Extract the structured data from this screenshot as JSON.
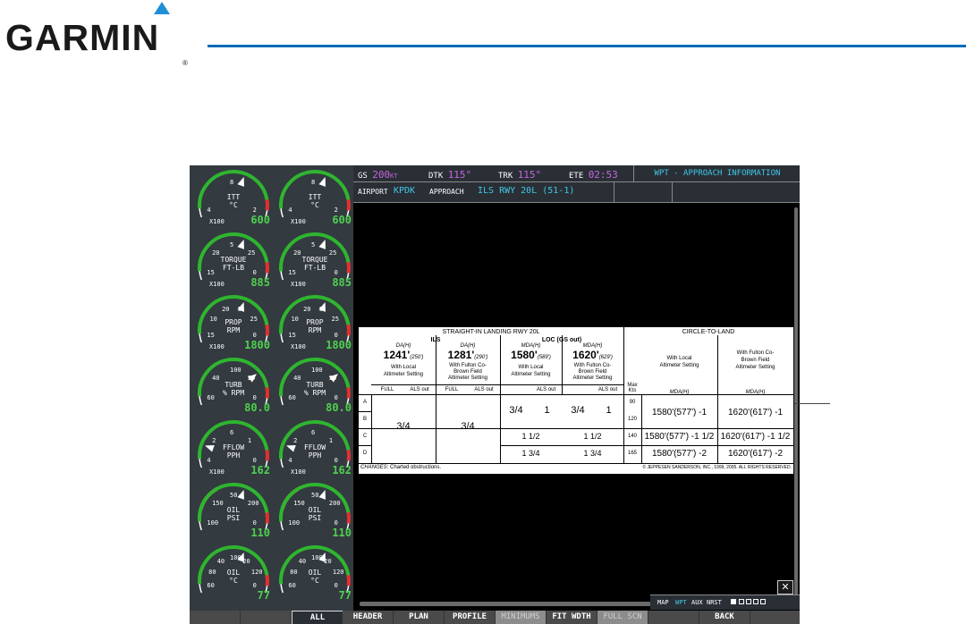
{
  "brand": {
    "name": "GARMIN",
    "reg": "®",
    "accent_color": "#1f8fd6"
  },
  "engine_gauges": [
    {
      "id": "itt-1",
      "label1": "ITT",
      "label2": "°C",
      "x100": "X100",
      "value": "600",
      "ticks": [
        "4",
        "8",
        "2"
      ]
    },
    {
      "id": "itt-2",
      "label1": "ITT",
      "label2": "°C",
      "x100": "X100",
      "value": "600",
      "ticks": [
        "4",
        "8",
        "2"
      ]
    },
    {
      "id": "torque-1",
      "label1": "TORQUE",
      "label2": "FT-LB",
      "x100": "X100",
      "value": "885",
      "ticks": [
        "15",
        "20",
        "5",
        "25",
        "0"
      ]
    },
    {
      "id": "torque-2",
      "label1": "TORQUE",
      "label2": "FT-LB",
      "x100": "X100",
      "value": "885",
      "ticks": [
        "15",
        "20",
        "5",
        "25",
        "0"
      ]
    },
    {
      "id": "prop-1",
      "label1": "PROP",
      "label2": "RPM",
      "x100": "X100",
      "value": "1800",
      "ticks": [
        "15",
        "10",
        "20",
        "5",
        "25",
        "0"
      ]
    },
    {
      "id": "prop-2",
      "label1": "PROP",
      "label2": "RPM",
      "x100": "X100",
      "value": "1800",
      "ticks": [
        "15",
        "10",
        "20",
        "5",
        "25",
        "0"
      ]
    },
    {
      "id": "turb-1",
      "label1": "TURB",
      "label2": "% RPM",
      "x100": "",
      "value": "80.0",
      "ticks": [
        "60",
        "40",
        "100",
        "20",
        "0"
      ]
    },
    {
      "id": "turb-2",
      "label1": "TURB",
      "label2": "% RPM",
      "x100": "",
      "value": "80.0",
      "ticks": [
        "60",
        "40",
        "100",
        "20",
        "0"
      ]
    },
    {
      "id": "fflow-1",
      "label1": "FFLOW",
      "label2": "PPH",
      "x100": "X100",
      "value": "162",
      "ticks": [
        "4",
        "2",
        "6",
        "1",
        "0"
      ]
    },
    {
      "id": "fflow-2",
      "label1": "FFLOW",
      "label2": "PPH",
      "x100": "X100",
      "value": "162",
      "ticks": [
        "4",
        "2",
        "6",
        "1",
        "0"
      ]
    },
    {
      "id": "oilpsi-1",
      "label1": "OIL",
      "label2": "PSI",
      "x100": "",
      "value": "110",
      "ticks": [
        "100",
        "150",
        "50",
        "200",
        "0"
      ]
    },
    {
      "id": "oilpsi-2",
      "label1": "OIL",
      "label2": "PSI",
      "x100": "",
      "value": "110",
      "ticks": [
        "100",
        "150",
        "50",
        "200",
        "0"
      ]
    },
    {
      "id": "oilc-1",
      "label1": "OIL",
      "label2": "°C",
      "x100": "",
      "value": "77",
      "ticks": [
        "60",
        "80",
        "40",
        "100",
        "20",
        "120",
        "0"
      ]
    },
    {
      "id": "oilc-2",
      "label1": "OIL",
      "label2": "°C",
      "x100": "",
      "value": "77",
      "ticks": [
        "60",
        "80",
        "40",
        "100",
        "20",
        "120",
        "0"
      ]
    }
  ],
  "navbar": {
    "gs_label": "GS",
    "gs_value": "200",
    "gs_unit": "KT",
    "dtk_label": "DTK",
    "dtk_value": "115°",
    "trk_label": "TRK",
    "trk_value": "115°",
    "ete_label": "ETE",
    "ete_value": "02:53",
    "page_title": "WPT - APPROACH INFORMATION"
  },
  "approach_bar": {
    "airport_label": "AIRPORT",
    "airport_value": "KPDK",
    "approach_label": "APPROACH",
    "approach_value": "ILS RWY 20L (51-1)"
  },
  "minimums": {
    "straight_in_title": "STRAIGHT-IN LANDING RWY 20L",
    "ils_title": "ILS",
    "loc_title": "LOC (GS out)",
    "circle_title": "CIRCLE-TO-LAND",
    "da_h": "DA(H)",
    "mda_h": "MDA(H)",
    "col1_value": "1241'",
    "col1_paren": "(250')",
    "col1_note1": "With Local",
    "col1_note2": "Altimeter Setting",
    "col2_value": "1281'",
    "col2_paren": "(290')",
    "col2_note1": "With Fulton Co-",
    "col2_note2": "Brown Field",
    "col2_note3": "Altimeter Setting",
    "col3_value": "1580'",
    "col3_paren": "(589')",
    "col3_note1": "With Local",
    "col3_note2": "Altimeter Setting",
    "col4_value": "1620'",
    "col4_paren": "(629')",
    "col4_note1": "With Fulton Co-",
    "col4_note2": "Brown Field",
    "col4_note3": "Altimeter Setting",
    "c2l_col1_note1": "With Local",
    "c2l_col1_note2": "Altimeter Setting",
    "c2l_col2_note1": "With Fulton Co-",
    "c2l_col2_note2": "Brown Field",
    "c2l_col2_note3": "Altimeter Setting",
    "full": "FULL",
    "als_out": "ALS out",
    "max_kts": "Max",
    "max_kts2": "Kts",
    "cat_labels": [
      "A",
      "B",
      "C",
      "D"
    ],
    "speeds": [
      "90",
      "120",
      "140",
      "165"
    ],
    "vis_ils": "3/4",
    "vis_loc_ab_full": "3/4",
    "vis_loc_ab_als": "1",
    "vis_loc_c": "1 1/2",
    "vis_loc_d": "1 3/4",
    "c2l_a": [
      "1580'(577') -1",
      "1620'(617') -1"
    ],
    "c2l_c": [
      "1580'(577') -1 1/2",
      "1620'(617') -1 1/2"
    ],
    "c2l_d": [
      "1580'(577') -2",
      "1620'(617') -2"
    ],
    "changes_label": "CHANGES:",
    "changes_text": "Charted obstructions.",
    "copyright": "© JEPPESEN SANDERSON, INC., 1999, 2005. ALL RIGHTS RESERVED."
  },
  "map_status": {
    "map": "MAP",
    "wpt": "WPT",
    "aux": "AUX",
    "nrst": "NRST"
  },
  "close_glyph": "✕",
  "softkeys": [
    "",
    "",
    "ALL",
    "HEADER",
    "PLAN",
    "PROFILE",
    "MINIMUMS",
    "FIT WDTH",
    "FULL SCN",
    "",
    "BACK",
    ""
  ]
}
